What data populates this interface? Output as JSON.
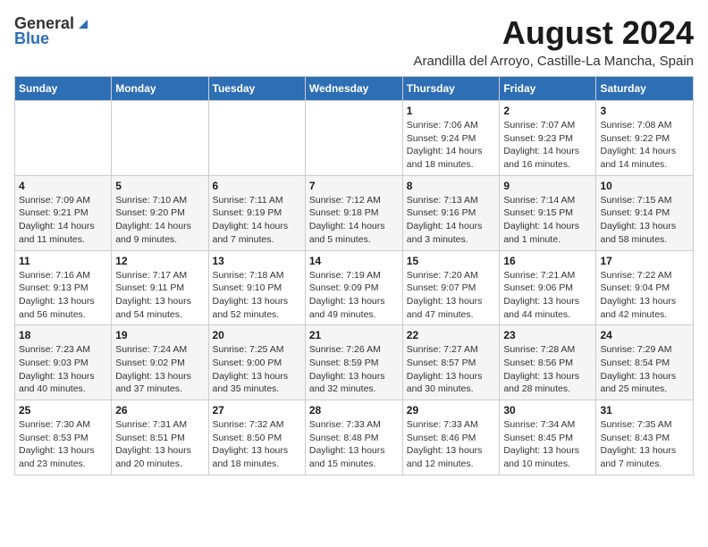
{
  "header": {
    "logo_general": "General",
    "logo_blue": "Blue",
    "main_title": "August 2024",
    "subtitle": "Arandilla del Arroyo, Castille-La Mancha, Spain"
  },
  "days_of_week": [
    "Sunday",
    "Monday",
    "Tuesday",
    "Wednesday",
    "Thursday",
    "Friday",
    "Saturday"
  ],
  "weeks": [
    [
      {
        "day": "",
        "info": ""
      },
      {
        "day": "",
        "info": ""
      },
      {
        "day": "",
        "info": ""
      },
      {
        "day": "",
        "info": ""
      },
      {
        "day": "1",
        "info": "Sunrise: 7:06 AM\nSunset: 9:24 PM\nDaylight: 14 hours\nand 18 minutes."
      },
      {
        "day": "2",
        "info": "Sunrise: 7:07 AM\nSunset: 9:23 PM\nDaylight: 14 hours\nand 16 minutes."
      },
      {
        "day": "3",
        "info": "Sunrise: 7:08 AM\nSunset: 9:22 PM\nDaylight: 14 hours\nand 14 minutes."
      }
    ],
    [
      {
        "day": "4",
        "info": "Sunrise: 7:09 AM\nSunset: 9:21 PM\nDaylight: 14 hours\nand 11 minutes."
      },
      {
        "day": "5",
        "info": "Sunrise: 7:10 AM\nSunset: 9:20 PM\nDaylight: 14 hours\nand 9 minutes."
      },
      {
        "day": "6",
        "info": "Sunrise: 7:11 AM\nSunset: 9:19 PM\nDaylight: 14 hours\nand 7 minutes."
      },
      {
        "day": "7",
        "info": "Sunrise: 7:12 AM\nSunset: 9:18 PM\nDaylight: 14 hours\nand 5 minutes."
      },
      {
        "day": "8",
        "info": "Sunrise: 7:13 AM\nSunset: 9:16 PM\nDaylight: 14 hours\nand 3 minutes."
      },
      {
        "day": "9",
        "info": "Sunrise: 7:14 AM\nSunset: 9:15 PM\nDaylight: 14 hours\nand 1 minute."
      },
      {
        "day": "10",
        "info": "Sunrise: 7:15 AM\nSunset: 9:14 PM\nDaylight: 13 hours\nand 58 minutes."
      }
    ],
    [
      {
        "day": "11",
        "info": "Sunrise: 7:16 AM\nSunset: 9:13 PM\nDaylight: 13 hours\nand 56 minutes."
      },
      {
        "day": "12",
        "info": "Sunrise: 7:17 AM\nSunset: 9:11 PM\nDaylight: 13 hours\nand 54 minutes."
      },
      {
        "day": "13",
        "info": "Sunrise: 7:18 AM\nSunset: 9:10 PM\nDaylight: 13 hours\nand 52 minutes."
      },
      {
        "day": "14",
        "info": "Sunrise: 7:19 AM\nSunset: 9:09 PM\nDaylight: 13 hours\nand 49 minutes."
      },
      {
        "day": "15",
        "info": "Sunrise: 7:20 AM\nSunset: 9:07 PM\nDaylight: 13 hours\nand 47 minutes."
      },
      {
        "day": "16",
        "info": "Sunrise: 7:21 AM\nSunset: 9:06 PM\nDaylight: 13 hours\nand 44 minutes."
      },
      {
        "day": "17",
        "info": "Sunrise: 7:22 AM\nSunset: 9:04 PM\nDaylight: 13 hours\nand 42 minutes."
      }
    ],
    [
      {
        "day": "18",
        "info": "Sunrise: 7:23 AM\nSunset: 9:03 PM\nDaylight: 13 hours\nand 40 minutes."
      },
      {
        "day": "19",
        "info": "Sunrise: 7:24 AM\nSunset: 9:02 PM\nDaylight: 13 hours\nand 37 minutes."
      },
      {
        "day": "20",
        "info": "Sunrise: 7:25 AM\nSunset: 9:00 PM\nDaylight: 13 hours\nand 35 minutes."
      },
      {
        "day": "21",
        "info": "Sunrise: 7:26 AM\nSunset: 8:59 PM\nDaylight: 13 hours\nand 32 minutes."
      },
      {
        "day": "22",
        "info": "Sunrise: 7:27 AM\nSunset: 8:57 PM\nDaylight: 13 hours\nand 30 minutes."
      },
      {
        "day": "23",
        "info": "Sunrise: 7:28 AM\nSunset: 8:56 PM\nDaylight: 13 hours\nand 28 minutes."
      },
      {
        "day": "24",
        "info": "Sunrise: 7:29 AM\nSunset: 8:54 PM\nDaylight: 13 hours\nand 25 minutes."
      }
    ],
    [
      {
        "day": "25",
        "info": "Sunrise: 7:30 AM\nSunset: 8:53 PM\nDaylight: 13 hours\nand 23 minutes."
      },
      {
        "day": "26",
        "info": "Sunrise: 7:31 AM\nSunset: 8:51 PM\nDaylight: 13 hours\nand 20 minutes."
      },
      {
        "day": "27",
        "info": "Sunrise: 7:32 AM\nSunset: 8:50 PM\nDaylight: 13 hours\nand 18 minutes."
      },
      {
        "day": "28",
        "info": "Sunrise: 7:33 AM\nSunset: 8:48 PM\nDaylight: 13 hours\nand 15 minutes."
      },
      {
        "day": "29",
        "info": "Sunrise: 7:33 AM\nSunset: 8:46 PM\nDaylight: 13 hours\nand 12 minutes."
      },
      {
        "day": "30",
        "info": "Sunrise: 7:34 AM\nSunset: 8:45 PM\nDaylight: 13 hours\nand 10 minutes."
      },
      {
        "day": "31",
        "info": "Sunrise: 7:35 AM\nSunset: 8:43 PM\nDaylight: 13 hours\nand 7 minutes."
      }
    ]
  ]
}
